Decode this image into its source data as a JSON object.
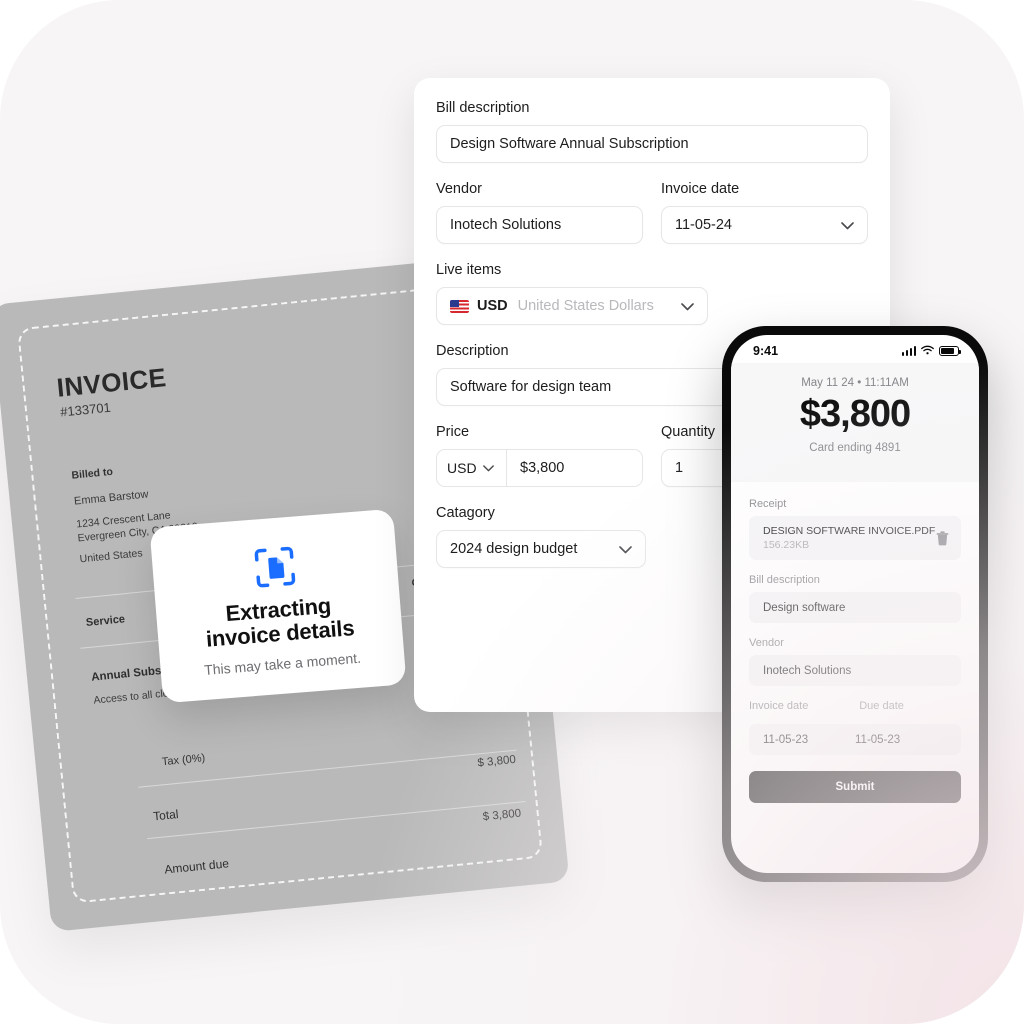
{
  "form": {
    "bill_description": {
      "label": "Bill description",
      "value": "Design Software Annual Subscription"
    },
    "vendor": {
      "label": "Vendor",
      "value": "Inotech Solutions"
    },
    "invoice_date": {
      "label": "Invoice date",
      "value": "11-05-24"
    },
    "live_items": {
      "label": "Live items",
      "currency_code": "USD",
      "currency_name": "United States Dollars"
    },
    "description": {
      "label": "Description",
      "value": "Software for design team"
    },
    "price": {
      "label": "Price",
      "currency": "USD",
      "value": "$3,800"
    },
    "quantity": {
      "label": "Quantity",
      "value": "1"
    },
    "category": {
      "label": "Catagory",
      "value": "2024 design budget"
    }
  },
  "extracting": {
    "icon": "document-scan-icon",
    "title_line1": "Extracting",
    "title_line2": "invoice details",
    "subtitle": "This may take a moment.",
    "accent": "#1A6DFF"
  },
  "invoice_doc": {
    "title": "INVOICE",
    "number": "#133701",
    "billed_to_label": "Billed to",
    "billed_to_name": "Emma Barstow",
    "address_line1": "1234 Crescent Lane",
    "address_line2": "Evergreen City, CA 90210",
    "country": "United States",
    "col_service": "Service",
    "col_qty": "Qty",
    "item_name": "Annual Subscription",
    "item_desc": "Access to all cloud s",
    "tax_label": "Tax (0%)",
    "total_label": "Total",
    "total_value": "$ 3,800",
    "amount_due_label": "Amount due",
    "amount_due_value": "$ 3,800"
  },
  "phone": {
    "status": {
      "time": "9:41",
      "signal": "signal-bars-icon",
      "wifi": "wifi-icon",
      "battery": "battery-icon"
    },
    "hero": {
      "date": "May 11 24 • 11:11AM",
      "amount": "$3,800",
      "card": "Card ending 4891"
    },
    "receipt": {
      "label": "Receipt",
      "file_name": "DESIGN SOFTWARE INVOICE.PDF",
      "file_size": "156.23KB",
      "delete_icon": "trash-icon"
    },
    "bill_description": {
      "label": "Bill description",
      "value": "Design software"
    },
    "vendor": {
      "label": "Vendor",
      "value": "Inotech Solutions"
    },
    "invoice_date": {
      "label": "Invoice date",
      "value": "11-05-23"
    },
    "due_date": {
      "label": "Due date",
      "value": "11-05-23"
    },
    "submit_label": "Submit"
  }
}
